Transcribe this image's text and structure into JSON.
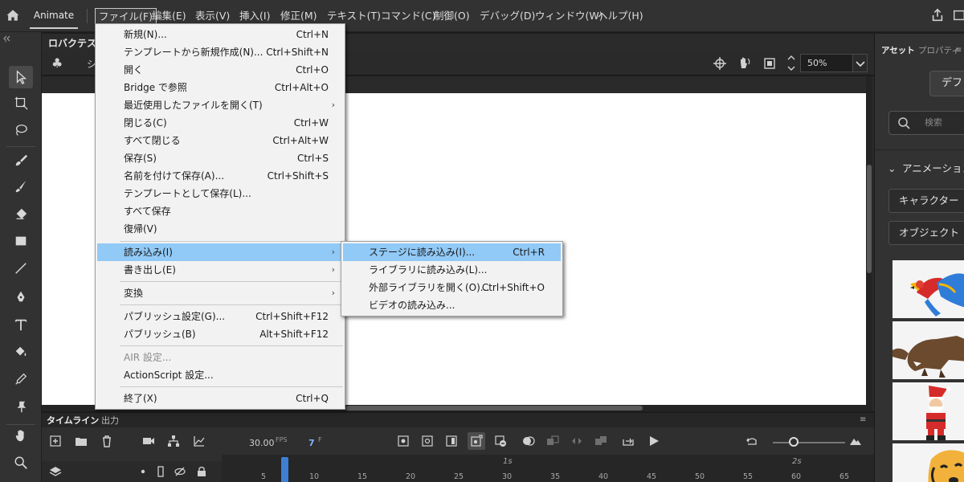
{
  "app": {
    "name": "Animate"
  },
  "menubar": {
    "items": [
      {
        "label": "ファイル(F)"
      },
      {
        "label": "編集(E)"
      },
      {
        "label": "表示(V)"
      },
      {
        "label": "挿入(I)"
      },
      {
        "label": "修正(M)"
      },
      {
        "label": "テキスト(T)"
      },
      {
        "label": "コマンド(C)"
      },
      {
        "label": "制御(O)"
      },
      {
        "label": "デバッグ(D)"
      },
      {
        "label": "ウィンドウ(W)"
      },
      {
        "label": "ヘルプ(H)"
      }
    ]
  },
  "document": {
    "tab_label": "ロバクテスト",
    "scene_label": "シ",
    "zoom": "50%"
  },
  "file_menu": {
    "items": [
      {
        "label": "新規(N)...",
        "shortcut": "Ctrl+N"
      },
      {
        "label": "テンプレートから新規作成(N)...",
        "shortcut": "Ctrl+Shift+N"
      },
      {
        "label": "開く",
        "shortcut": "Ctrl+O"
      },
      {
        "label": "Bridge で参照",
        "shortcut": "Ctrl+Alt+O"
      },
      {
        "label": "最近使用したファイルを開く(T)",
        "shortcut": ""
      },
      {
        "label": "閉じる(C)",
        "shortcut": "Ctrl+W"
      },
      {
        "label": "すべて閉じる",
        "shortcut": "Ctrl+Alt+W"
      },
      {
        "label": "保存(S)",
        "shortcut": "Ctrl+S"
      },
      {
        "label": "名前を付けて保存(A)...",
        "shortcut": "Ctrl+Shift+S"
      },
      {
        "label": "テンプレートとして保存(L)...",
        "shortcut": ""
      },
      {
        "label": "すべて保存",
        "shortcut": ""
      },
      {
        "label": "復帰(V)",
        "shortcut": ""
      },
      {
        "label": "読み込み(I)",
        "shortcut": ""
      },
      {
        "label": "書き出し(E)",
        "shortcut": ""
      },
      {
        "label": "変換",
        "shortcut": ""
      },
      {
        "label": "パブリッシュ設定(G)...",
        "shortcut": "Ctrl+Shift+F12"
      },
      {
        "label": "パブリッシュ(B)",
        "shortcut": "Alt+Shift+F12"
      },
      {
        "label": "AIR 設定...",
        "shortcut": ""
      },
      {
        "label": "ActionScript 設定...",
        "shortcut": ""
      },
      {
        "label": "終了(X)",
        "shortcut": "Ctrl+Q"
      }
    ],
    "arrow": "›"
  },
  "import_menu": {
    "items": [
      {
        "label": "ステージに読み込み(I)...",
        "shortcut": "Ctrl+R"
      },
      {
        "label": "ライブラリに読み込み(L)...",
        "shortcut": ""
      },
      {
        "label": "外部ライブラリを開く(O)...",
        "shortcut": "Ctrl+Shift+O"
      },
      {
        "label": "ビデオの読み込み...",
        "shortcut": ""
      }
    ]
  },
  "timeline": {
    "tab_timeline": "タイムライン",
    "tab_output": "出力",
    "fps": "30.00",
    "fps_unit": "FPS",
    "frame": "7",
    "frame_unit": "F",
    "ruler_seconds": [
      "1s",
      "2s"
    ],
    "ruler_frames": [
      "5",
      "10",
      "15",
      "20",
      "25",
      "30",
      "35",
      "40",
      "45",
      "50",
      "55",
      "60",
      "65"
    ]
  },
  "right_panel": {
    "tab_assets": "アセット",
    "tab_properties": "プロパティ",
    "default_button": "デフォ",
    "search_placeholder": "検索",
    "section_title": "アニメーション",
    "dropdown_character": "キャラクター",
    "dropdown_object": "オブジェクト"
  }
}
